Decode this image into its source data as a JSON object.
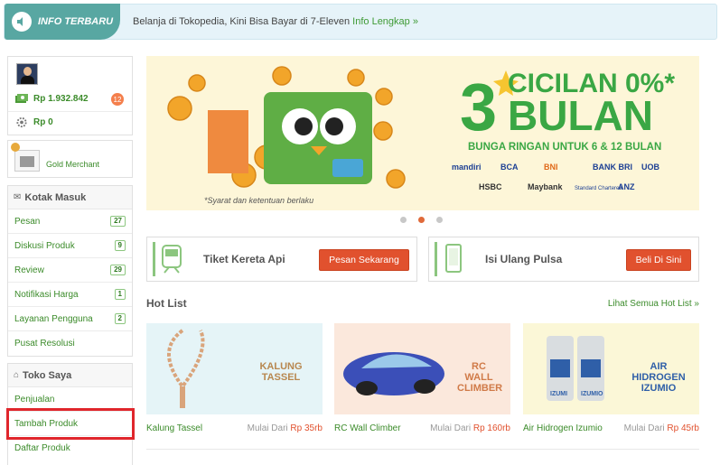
{
  "infobar": {
    "tag": "INFO TERBARU",
    "message": "Belanja di Tokopedia, Kini Bisa Bayar di 7-Eleven",
    "link": "Info Lengkap »"
  },
  "profile": {
    "saldo": "Rp 1.932.842",
    "saldo_badge": "12",
    "points": "Rp 0"
  },
  "merchant": {
    "label": "Gold Merchant"
  },
  "inbox": {
    "title": "Kotak Masuk",
    "items": [
      {
        "label": "Pesan",
        "count": "27"
      },
      {
        "label": "Diskusi Produk",
        "count": "9"
      },
      {
        "label": "Review",
        "count": "29"
      },
      {
        "label": "Notifikasi Harga",
        "count": "1"
      },
      {
        "label": "Layanan Pengguna",
        "count": "2"
      },
      {
        "label": "Pusat Resolusi",
        "count": ""
      }
    ]
  },
  "shop": {
    "title": "Toko Saya",
    "items": [
      {
        "label": "Penjualan"
      },
      {
        "label": "Tambah Produk"
      },
      {
        "label": "Daftar Produk"
      }
    ]
  },
  "banner": {
    "number": "3",
    "line1": "CICILAN 0%*",
    "line2": "BULAN",
    "sub": "BUNGA RINGAN UNTUK 6 & 12 BULAN",
    "disclaimer": "*Syarat dan ketentuan berlaku",
    "banks_row1": [
      "mandiri",
      "BCA",
      "BNI",
      "BANK BRI",
      "UOB"
    ],
    "banks_row2": [
      "HSBC",
      "Maybank",
      "Standard Chartered",
      "ANZ"
    ]
  },
  "promos": [
    {
      "title": "Tiket Kereta Api",
      "button": "Pesan Sekarang",
      "icon": "train-icon"
    },
    {
      "title": "Isi Ulang Pulsa",
      "button": "Beli Di Sini",
      "icon": "phone-icon"
    }
  ],
  "hotlist": {
    "title": "Hot List",
    "see_all": "Lihat Semua Hot List »",
    "items": [
      {
        "name": "Kalung Tassel",
        "price_prefix": "Mulai Dari",
        "price": "Rp 35rb",
        "img_text": "KALUNG TASSEL",
        "bg": "#e5f4f7"
      },
      {
        "name": "RC Wall Climber",
        "price_prefix": "Mulai Dari",
        "price": "Rp 160rb",
        "img_text": "RC WALL CLIMBER",
        "bg": "#fbe8dc"
      },
      {
        "name": "Air Hidrogen Izumio",
        "price_prefix": "Mulai Dari",
        "price": "Rp 45rb",
        "img_text": "AIR HIDROGEN IZUMIO",
        "bg": "#fbf7d7"
      }
    ]
  },
  "colors": {
    "green": "#3b8b2a",
    "orange": "#e1512e",
    "teal": "#58a7a2"
  }
}
